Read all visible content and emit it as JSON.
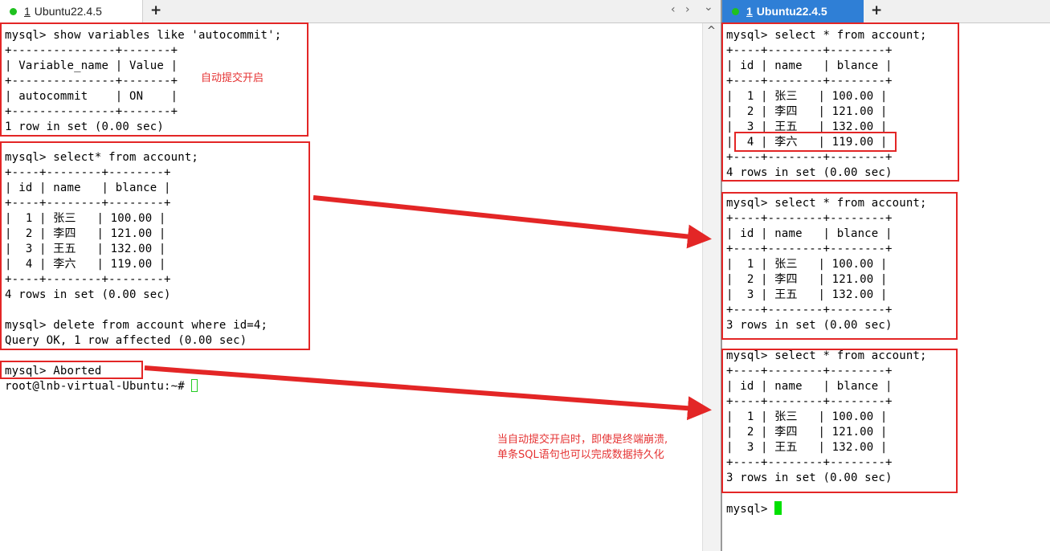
{
  "tabs": {
    "left": {
      "number": "1",
      "title": "Ubuntu22.4.5"
    },
    "right": {
      "number": "1",
      "title": "Ubuntu22.4.5"
    },
    "new_tab_symbol": "+",
    "nav_prev": "‹",
    "nav_next": "›",
    "dropdown": "⌄"
  },
  "left_terminal": {
    "lines": [
      "mysql> show variables like 'autocommit';",
      "+---------------+-------+",
      "| Variable_name | Value |",
      "+---------------+-------+",
      "| autocommit    | ON    |",
      "+---------------+-------+",
      "1 row in set (0.00 sec)",
      "",
      "mysql> select* from account;",
      "+----+--------+--------+",
      "| id | name   | blance |",
      "+----+--------+--------+",
      "|  1 | 张三   | 100.00 |",
      "|  2 | 李四   | 121.00 |",
      "|  3 | 王五   | 132.00 |",
      "|  4 | 李六   | 119.00 |",
      "+----+--------+--------+",
      "4 rows in set (0.00 sec)",
      "",
      "mysql> delete from account where id=4;",
      "Query OK, 1 row affected (0.00 sec)",
      "",
      "mysql> Aborted"
    ],
    "prompt_line": "root@lnb-virtual-Ubuntu:~# "
  },
  "right_terminal": {
    "lines": [
      "mysql> select * from account;",
      "+----+--------+--------+",
      "| id | name   | blance |",
      "+----+--------+--------+",
      "|  1 | 张三   | 100.00 |",
      "|  2 | 李四   | 121.00 |",
      "|  3 | 王五   | 132.00 |",
      "|  4 | 李六   | 119.00 |",
      "+----+--------+--------+",
      "4 rows in set (0.00 sec)",
      "",
      "mysql> select * from account;",
      "+----+--------+--------+",
      "| id | name   | blance |",
      "+----+--------+--------+",
      "|  1 | 张三   | 100.00 |",
      "|  2 | 李四   | 121.00 |",
      "|  3 | 王五   | 132.00 |",
      "+----+--------+--------+",
      "3 rows in set (0.00 sec)",
      "",
      "mysql> select * from account;",
      "+----+--------+--------+",
      "| id | name   | blance |",
      "+----+--------+--------+",
      "|  1 | 张三   | 100.00 |",
      "|  2 | 李四   | 121.00 |",
      "|  3 | 王五   | 132.00 |",
      "+----+--------+--------+",
      "3 rows in set (0.00 sec)",
      "",
      "mysql> "
    ]
  },
  "annotations": {
    "autocommit_on": "自动提交开启",
    "note_line1": "当自动提交开启时，即使是终端崩溃,",
    "note_line2": "单条SQL语句也可以完成数据持久化"
  },
  "colors": {
    "annotation_red": "#e32626",
    "cursor_green": "#00e000",
    "active_tab_blue": "#2f7fd6",
    "status_dot_green": "#1fc11f"
  }
}
